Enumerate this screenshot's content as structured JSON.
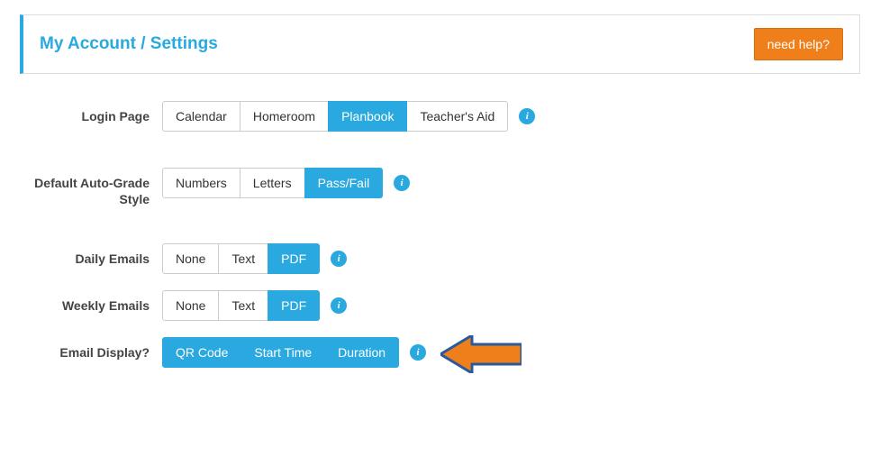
{
  "header": {
    "title": "My Account / Settings",
    "help_label": "need help?"
  },
  "rows": {
    "login_page": {
      "label": "Login Page",
      "options": [
        "Calendar",
        "Homeroom",
        "Planbook",
        "Teacher's Aid"
      ],
      "selected": "Planbook"
    },
    "auto_grade": {
      "label": "Default Auto-Grade Style",
      "options": [
        "Numbers",
        "Letters",
        "Pass/Fail"
      ],
      "selected": "Pass/Fail"
    },
    "daily_emails": {
      "label": "Daily Emails",
      "options": [
        "None",
        "Text",
        "PDF"
      ],
      "selected": "PDF"
    },
    "weekly_emails": {
      "label": "Weekly Emails",
      "options": [
        "None",
        "Text",
        "PDF"
      ],
      "selected": "PDF"
    },
    "email_display": {
      "label": "Email Display?",
      "options": [
        "QR Code",
        "Start Time",
        "Duration"
      ],
      "selected_all": true
    }
  },
  "info_glyph": "i"
}
